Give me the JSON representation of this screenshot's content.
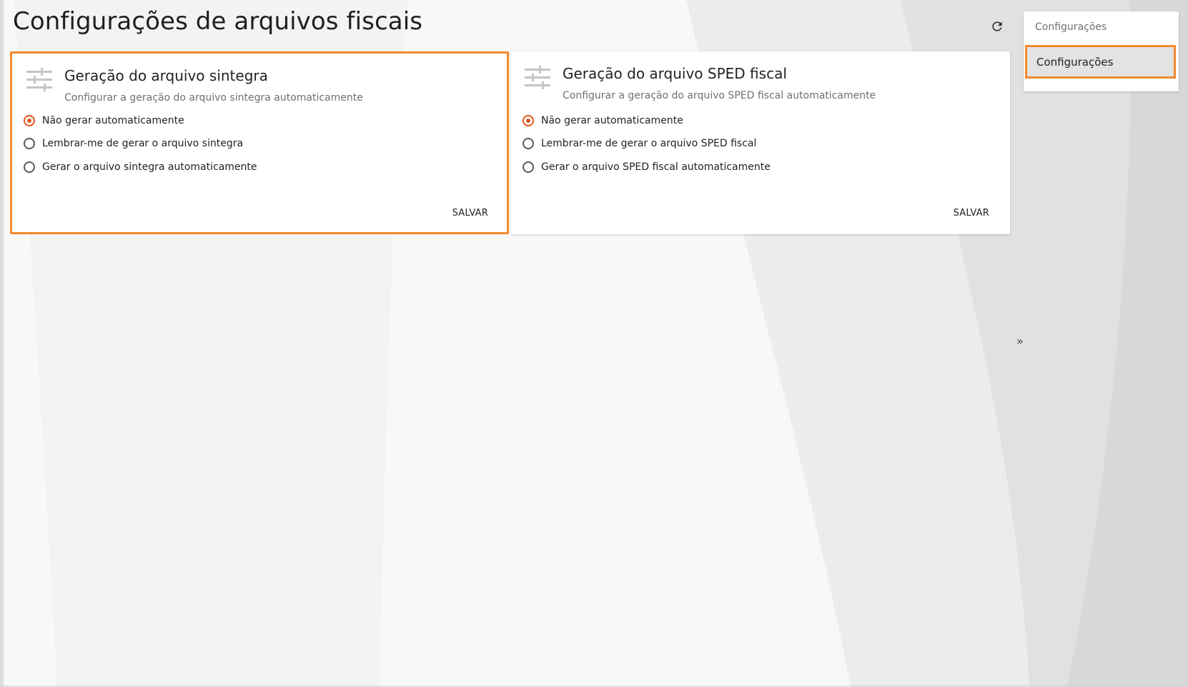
{
  "page": {
    "title": "Configurações de arquivos fiscais",
    "refresh_icon": "refresh-icon"
  },
  "cards": [
    {
      "title": "Geração do arquivo sintegra",
      "subtitle": "Configurar a geração do arquivo sintegra automaticamente",
      "icon": "tune-sliders-icon",
      "options": [
        {
          "label": "Não gerar automaticamente",
          "checked": true
        },
        {
          "label": "Lembrar-me de gerar o arquivo sintegra",
          "checked": false
        },
        {
          "label": "Gerar o arquivo sintegra automaticamente",
          "checked": false
        }
      ],
      "save_label": "SALVAR"
    },
    {
      "title": "Geração do arquivo SPED fiscal",
      "subtitle": "Configurar a geração do arquivo SPED fiscal automaticamente",
      "icon": "tune-sliders-icon",
      "options": [
        {
          "label": "Não gerar automaticamente",
          "checked": true
        },
        {
          "label": "Lembrar-me de gerar o arquivo SPED fiscal",
          "checked": false
        },
        {
          "label": "Gerar o arquivo SPED fiscal automaticamente",
          "checked": false
        }
      ],
      "save_label": "SALVAR"
    }
  ],
  "side_panel": {
    "header": "Configurações",
    "items": [
      {
        "label": "Configurações",
        "selected": true
      }
    ],
    "collapse_label": "»"
  },
  "colors": {
    "accent": "#e2551d",
    "highlight_border": "#f28a2e",
    "background": "#f7f7f7"
  }
}
